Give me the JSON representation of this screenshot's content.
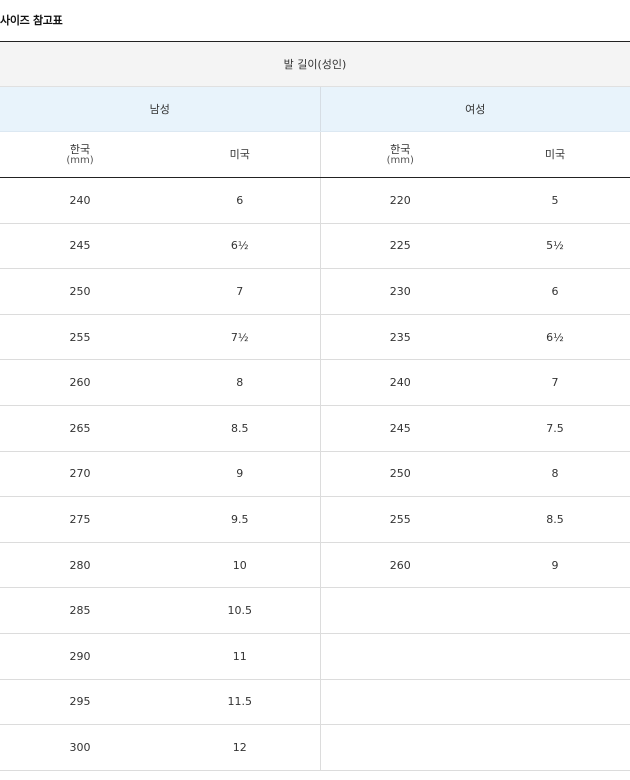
{
  "title": "사이즈 참고표",
  "table": {
    "group_header": "발 길이(성인)",
    "men_label": "남성",
    "women_label": "여성",
    "columns": {
      "korea_label": "한국",
      "korea_unit": "(mm)",
      "us_label": "미국"
    },
    "rows": [
      {
        "men_kr": "240",
        "men_us": "6",
        "women_kr": "220",
        "women_us": "5"
      },
      {
        "men_kr": "245",
        "men_us": "6½",
        "women_kr": "225",
        "women_us": "5½"
      },
      {
        "men_kr": "250",
        "men_us": "7",
        "women_kr": "230",
        "women_us": "6"
      },
      {
        "men_kr": "255",
        "men_us": "7½",
        "women_kr": "235",
        "women_us": "6½"
      },
      {
        "men_kr": "260",
        "men_us": "8",
        "women_kr": "240",
        "women_us": "7"
      },
      {
        "men_kr": "265",
        "men_us": "8.5",
        "women_kr": "245",
        "women_us": "7.5"
      },
      {
        "men_kr": "270",
        "men_us": "9",
        "women_kr": "250",
        "women_us": "8"
      },
      {
        "men_kr": "275",
        "men_us": "9.5",
        "women_kr": "255",
        "women_us": "8.5"
      },
      {
        "men_kr": "280",
        "men_us": "10",
        "women_kr": "260",
        "women_us": "9"
      },
      {
        "men_kr": "285",
        "men_us": "10.5",
        "women_kr": "",
        "women_us": ""
      },
      {
        "men_kr": "290",
        "men_us": "11",
        "women_kr": "",
        "women_us": ""
      },
      {
        "men_kr": "295",
        "men_us": "11.5",
        "women_kr": "",
        "women_us": ""
      },
      {
        "men_kr": "300",
        "men_us": "12",
        "women_kr": "",
        "women_us": ""
      }
    ]
  }
}
